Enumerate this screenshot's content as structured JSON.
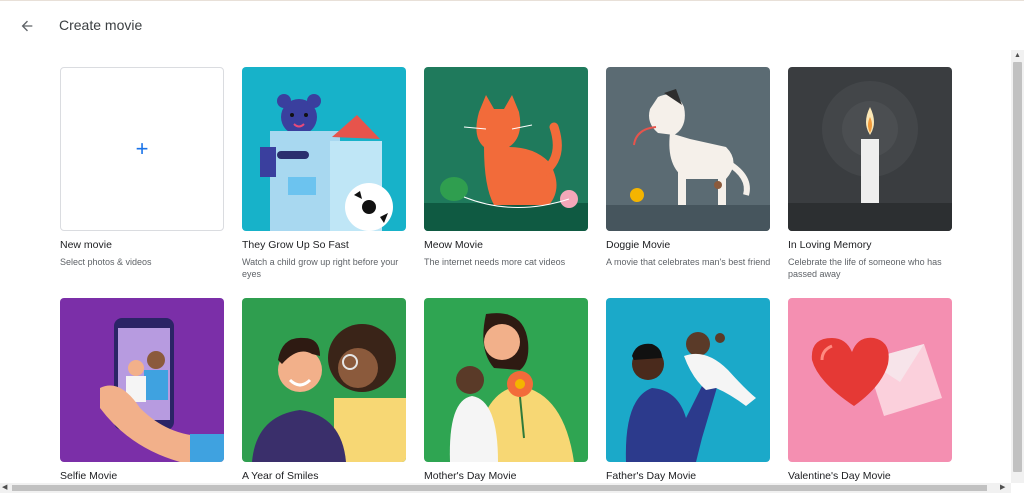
{
  "header": {
    "title": "Create movie",
    "back_icon": "arrow-back-icon"
  },
  "cards_row1": [
    {
      "title": "New movie",
      "subtitle": "Select photos & videos"
    },
    {
      "title": "They Grow Up So Fast",
      "subtitle": "Watch a child grow up right before your eyes"
    },
    {
      "title": "Meow Movie",
      "subtitle": "The internet needs more cat videos"
    },
    {
      "title": "Doggie Movie",
      "subtitle": "A movie that celebrates man's best friend"
    },
    {
      "title": "In Loving Memory",
      "subtitle": "Celebrate the life of someone who has passed away"
    }
  ],
  "cards_row2": [
    {
      "title": "Selfie Movie"
    },
    {
      "title": "A Year of Smiles"
    },
    {
      "title": "Mother's Day Movie"
    },
    {
      "title": "Father's Day Movie"
    },
    {
      "title": "Valentine's Day Movie"
    }
  ],
  "colors": {
    "accent": "#1a73e8",
    "grow_up_bg": "#17b2c9",
    "meow_bg": "#1f7a5c",
    "doggie_bg": "#5b6b73",
    "memory_bg": "#3a3d40",
    "selfie_bg": "#7b2fa8",
    "smiles_bg": "#2f9e4f",
    "mothers_bg": "#2fa552",
    "fathers_bg": "#1ba9c9",
    "valentine_bg": "#f48fb1"
  },
  "new_movie_icon": "+"
}
